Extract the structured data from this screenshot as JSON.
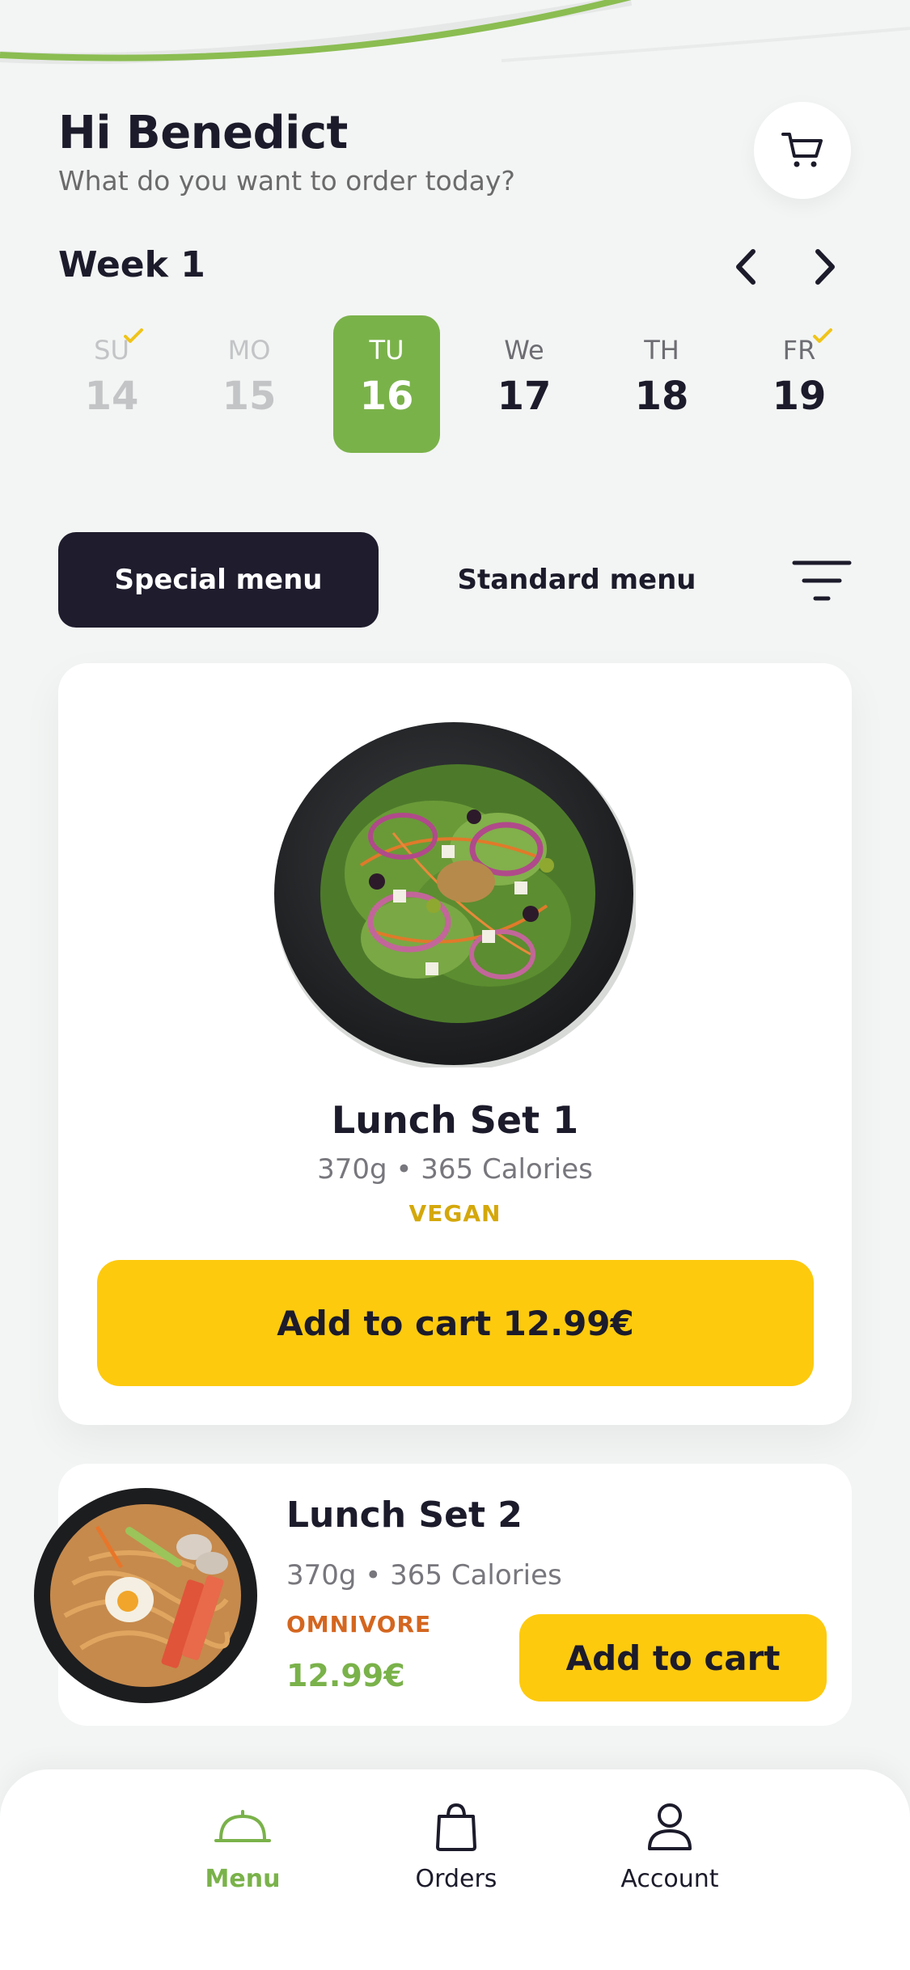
{
  "header": {
    "greeting": "Hi Benedict",
    "subtitle": "What do you want to order today?",
    "cart_icon": "cart-icon"
  },
  "week": {
    "label": "Week 1",
    "days": [
      {
        "name": "SU",
        "number": "14",
        "state": "past",
        "checked": true
      },
      {
        "name": "MO",
        "number": "15",
        "state": "past",
        "checked": false
      },
      {
        "name": "TU",
        "number": "16",
        "state": "selected",
        "checked": false
      },
      {
        "name": "We",
        "number": "17",
        "state": "upcoming",
        "checked": false
      },
      {
        "name": "TH",
        "number": "18",
        "state": "upcoming",
        "checked": false
      },
      {
        "name": "FR",
        "number": "19",
        "state": "upcoming",
        "checked": true
      }
    ]
  },
  "menu_tabs": {
    "special": "Special menu",
    "standard": "Standard menu",
    "active": "special"
  },
  "items": [
    {
      "title": "Lunch Set 1",
      "meta": "370g • 365 Calories",
      "tag": "VEGAN",
      "button": "Add to cart 12.99€"
    },
    {
      "title": "Lunch Set 2",
      "meta": "370g • 365 Calories",
      "tag": "OMNIVORE",
      "price": "12.99€",
      "button": "Add to cart"
    }
  ],
  "nav": {
    "menu": "Menu",
    "orders": "Orders",
    "account": "Account",
    "active": "menu"
  },
  "colors": {
    "accent_green": "#7ab24a",
    "accent_yellow": "#fdca0e",
    "dark": "#1e1c2d",
    "vegan_tag": "#d4a80b",
    "omnivore_tag": "#d4661f"
  }
}
